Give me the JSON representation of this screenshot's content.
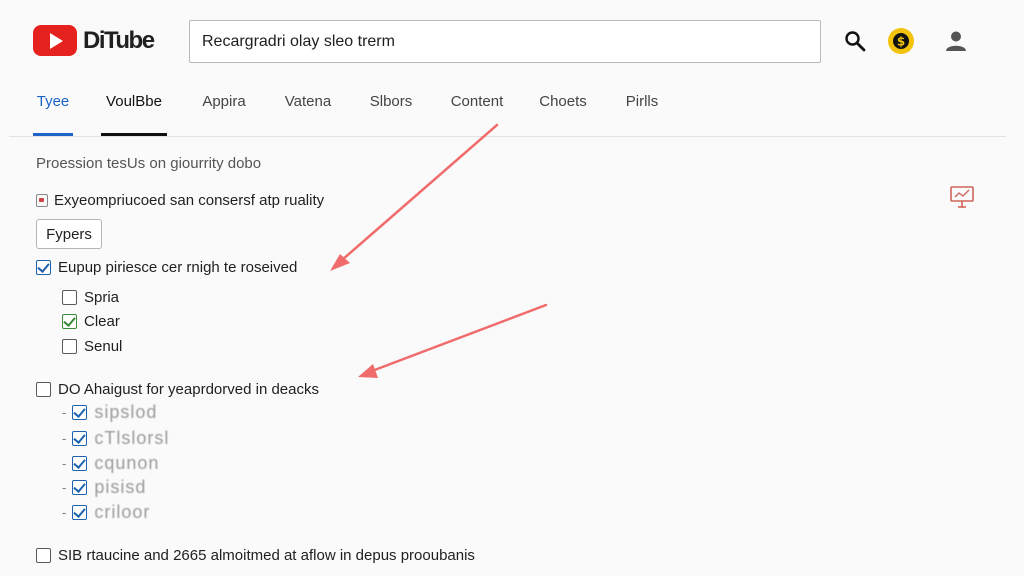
{
  "header": {
    "logo_text": "DiTube",
    "search_value": "Recargradri olay sleo trerm"
  },
  "icons": {
    "search": "search-icon",
    "coin": "coin-icon",
    "account": "account-icon",
    "presentation": "presentation-icon"
  },
  "tabs": [
    {
      "label": "Tyee"
    },
    {
      "label": "VoulBbe"
    },
    {
      "label": "Appira"
    },
    {
      "label": "Vatena"
    },
    {
      "label": "Slbors"
    },
    {
      "label": "Content"
    },
    {
      "label": "Choets"
    },
    {
      "label": "Pirlls"
    }
  ],
  "content": {
    "section_note": "Proession tesUs on giourrity dobo",
    "info_text": "Exyeompriucoed  san consersf atp ruality",
    "filter_button": "Fypers",
    "group1": {
      "label": "Eupup piriesce cer rnigh te roseived",
      "options": [
        {
          "label": "Spria"
        },
        {
          "label": "Clear"
        },
        {
          "label": "Senul"
        }
      ]
    },
    "group2": {
      "label": "DO Ahaigust for yeaprdorved in deacks",
      "items": [
        {
          "label": "sipslod"
        },
        {
          "label": "cTlslorsl"
        },
        {
          "label": "cqunon"
        },
        {
          "label": "pisisd"
        },
        {
          "label": "criloor"
        }
      ]
    },
    "footer_option": "SIB rtaucine and 2665 almoitmed at aflow in depus prooubanis"
  },
  "colors": {
    "brand_red": "#e5221d",
    "accent_blue": "#1e64c8",
    "arrow": "#f06b6b",
    "coin": "#f2c20c"
  }
}
